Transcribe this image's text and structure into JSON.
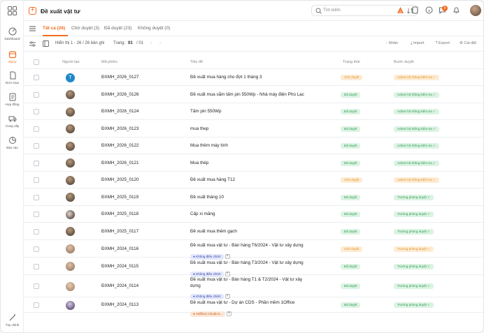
{
  "sidebar": {
    "items": [
      {
        "label": "Dashboard",
        "icon": "dashboard-icon"
      },
      {
        "label": "Vật tư",
        "icon": "box-icon",
        "active": true
      },
      {
        "label": "Đơn mua",
        "icon": "document-icon"
      },
      {
        "label": "Hợp đồng",
        "icon": "contract-icon"
      },
      {
        "label": "Cung cấp",
        "icon": "truck-icon"
      },
      {
        "label": "Báo cáo",
        "icon": "chart-pie-icon"
      }
    ],
    "settings_label": "Tùy chỉnh"
  },
  "header": {
    "title": "Đề xuất vật tư",
    "search_placeholder": "Tìm kiếm",
    "notification_count": "9"
  },
  "tabs": [
    {
      "label": "Tất cả (26)",
      "active": true
    },
    {
      "label": "Chờ duyệt (3)"
    },
    {
      "label": "Đã duyệt (23)"
    },
    {
      "label": "Không duyệt (0)"
    }
  ],
  "toolbar": {
    "showing": "Hiển thị 1 - 26 / 26 bản ghi",
    "page_label": "Trang:",
    "page_current": "01",
    "page_total": "/ 01",
    "actions": [
      "Nhãn",
      "Import",
      "Export",
      "Cài đặt"
    ]
  },
  "columns": [
    "Người tạo",
    "Mã phiếu",
    "Tiêu đề",
    "Trạng thái",
    "Bước duyệt"
  ],
  "rows": [
    {
      "avatar": "T",
      "code": "ĐXMH_2026_0127",
      "title": "Đề xuất mua hàng cho đợt 1 tháng 3",
      "status": "Chờ duyệt",
      "step": "Admin hệ thống kiểm tra ✓"
    },
    {
      "code": "ĐXMH_2026_0126",
      "title": "Đề xuất mua sắm tấm pin 550Wp - Nhà máy điện Phú Lạc",
      "status": "Đã duyệt",
      "step": "Admin hệ thống kiểm tra ✓"
    },
    {
      "code": "ĐXMH_2026_0124",
      "title": "Tấm pin 550Wp",
      "status": "Đã duyệt",
      "step": "Admin hệ thống kiểm tra ✓"
    },
    {
      "code": "ĐXMH_2026_0123",
      "title": "mua thep",
      "status": "Đã duyệt",
      "step": "Admin hệ thống kiểm tra ✓"
    },
    {
      "code": "ĐXMH_2026_0122",
      "title": "Mua thêm máy tính",
      "status": "Đã duyệt",
      "step": "Admin hệ thống kiểm tra ✓"
    },
    {
      "code": "ĐXMH_2026_0121",
      "title": "Mua thép",
      "status": "Đã duyệt",
      "step": "Admin hệ thống kiểm tra ✓"
    },
    {
      "code": "ĐXMH_2025_0120",
      "title": "Đề xuất mua hàng T12",
      "status": "Chờ duyệt",
      "step": "Admin hệ thống kiểm tra ✓"
    },
    {
      "code": "ĐXMH_2025_0119",
      "title": "Đề xuất tháng 10",
      "status": "Đã duyệt",
      "step": "Trưởng phòng duyệt ✓"
    },
    {
      "code": "ĐXMH_2025_0118",
      "title": "Cấp xi măng",
      "status": "Đã duyệt",
      "step": "Trưởng phòng duyệt ✓"
    },
    {
      "code": "ĐXMH_2025_0117",
      "title": "Đề xuất mua thêm gạch",
      "status": "Đã duyệt",
      "step": "Trưởng phòng duyệt ✓"
    },
    {
      "code": "ĐXMH_2024_0116",
      "title": "Đề xuất mua vật tư - Bàn hàng T6/2024 - Vật tư xây dựng",
      "tag": "Không điều chỉnh",
      "status": "Chờ duyệt",
      "step": "Trưởng phòng duyệt ✓"
    },
    {
      "code": "ĐXMH_2024_0115",
      "title": "Đề xuất mua vật tư - Bàn hàng T3/2024 - Vật tư xây dựng",
      "tag": "Không điều chỉnh",
      "status": "Đã duyệt",
      "step": "Trưởng phòng duyệt ✓"
    },
    {
      "code": "ĐXMH_2024_0114",
      "title": "Đề xuất mua vật tư - Bàn hàng T1 & T2/2024 - Vật tư xây",
      "title2": "dựng",
      "tag": "Không điều chỉnh",
      "status": "Đã duyệt",
      "step": "Trưởng phòng duyệt ✓"
    },
    {
      "code": "ĐXMH_2024_0113",
      "title": "Đề xuất mua vật tư - Dự án CDS - Phần mềm 1Office",
      "tag": "1Office) Chuẩn k...",
      "tag_orange": true,
      "status": "Đã duyệt",
      "step": "Trưởng phòng duyệt ✓"
    }
  ]
}
